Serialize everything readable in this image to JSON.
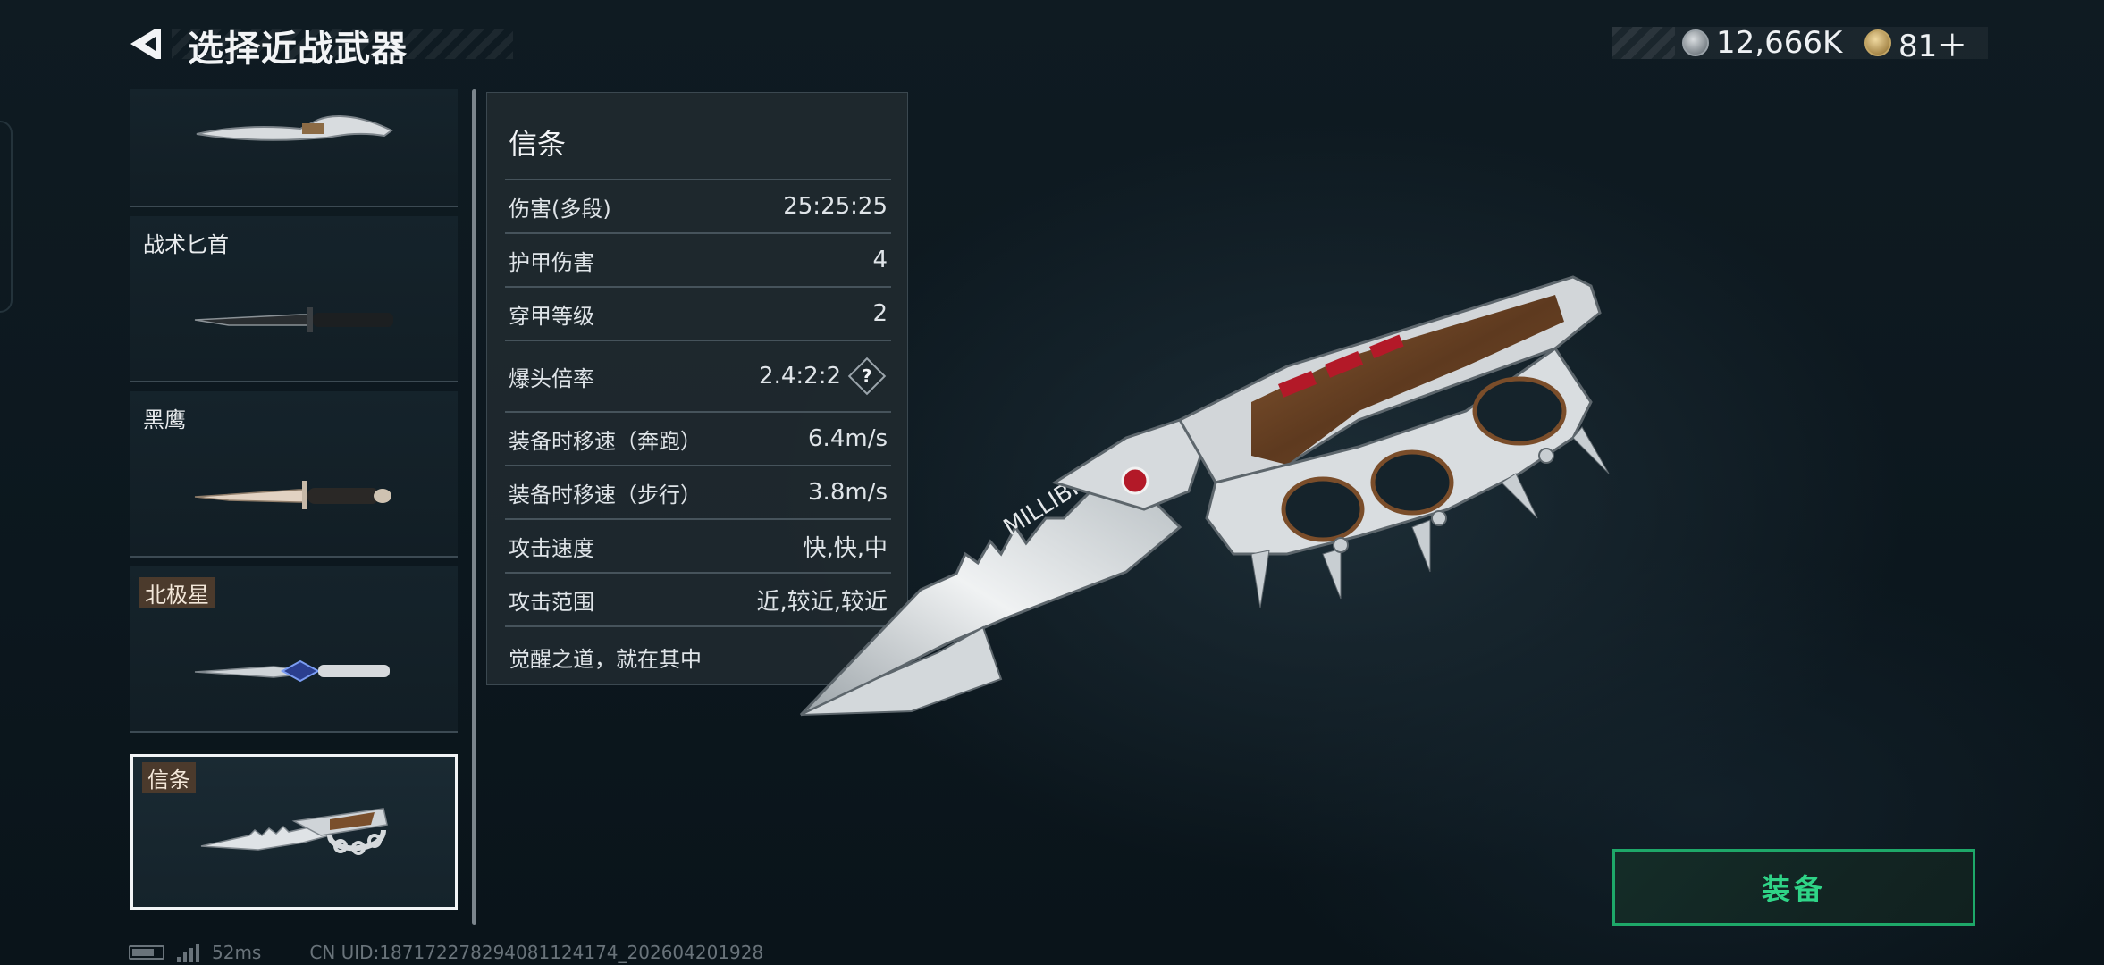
{
  "header": {
    "title": "选择近战武器",
    "back_icon": "back-arrow-icon"
  },
  "currencies": [
    {
      "icon": "silver-coin-icon",
      "value": "12,666K"
    },
    {
      "icon": "gold-coin-icon",
      "value": "81＋"
    }
  ],
  "weapon_list": [
    {
      "label": "",
      "tagged": false,
      "selected": false
    },
    {
      "label": "战术匕首",
      "tagged": false,
      "selected": false
    },
    {
      "label": "黑鹰",
      "tagged": false,
      "selected": false
    },
    {
      "label": "北极星",
      "tagged": true,
      "selected": false
    },
    {
      "label": "信条",
      "tagged": true,
      "selected": true
    }
  ],
  "stats": {
    "name": "信条",
    "rows": [
      {
        "label": "伤害(多段)",
        "value": "25:25:25"
      },
      {
        "label": "护甲伤害",
        "value": "4"
      },
      {
        "label": "穿甲等级",
        "value": "2"
      },
      {
        "label": "爆头倍率",
        "value": "2.4:2:2",
        "help": "?"
      },
      {
        "label": "装备时移速（奔跑）",
        "value": "6.4m/s"
      },
      {
        "label": "装备时移速（步行）",
        "value": "3.8m/s"
      },
      {
        "label": "攻击速度",
        "value": "快,快,中"
      },
      {
        "label": "攻击范围",
        "value": "近,较近,较近"
      }
    ],
    "description": "觉醒之道，就在其中"
  },
  "equip_button": {
    "label": "装备",
    "color": "#2fd487"
  },
  "footer": {
    "ping": "52ms",
    "uid": "CN UID:18717227829408112417​4_202604201928"
  },
  "colors": {
    "accent_green": "#1ea869",
    "panel": "#1f292f",
    "background": "#0e1a21"
  }
}
